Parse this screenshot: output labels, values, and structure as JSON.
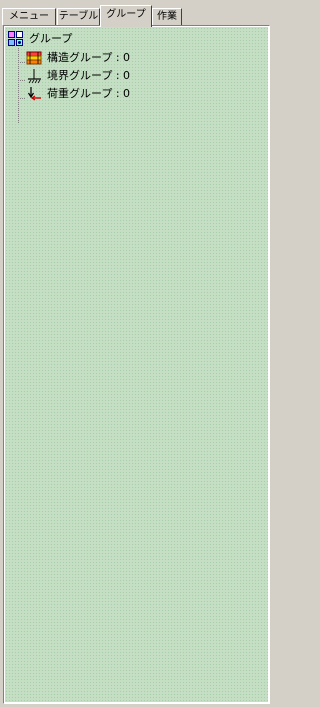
{
  "tabs": [
    {
      "label": "メニュー",
      "active": false
    },
    {
      "label": "テーブル",
      "active": false
    },
    {
      "label": "グループ",
      "active": true
    },
    {
      "label": "作業",
      "active": false
    }
  ],
  "tree": {
    "root": {
      "label": "グループ",
      "icon": "group-root-icon"
    },
    "children": [
      {
        "label": "構造グループ : 0",
        "icon": "structure-group-icon"
      },
      {
        "label": "境界グループ : 0",
        "icon": "boundary-group-icon"
      },
      {
        "label": "荷重グループ : 0",
        "icon": "load-group-icon"
      }
    ]
  },
  "colors": {
    "tree_background": "#c4dfc4",
    "window_face": "#d4d0c8"
  }
}
